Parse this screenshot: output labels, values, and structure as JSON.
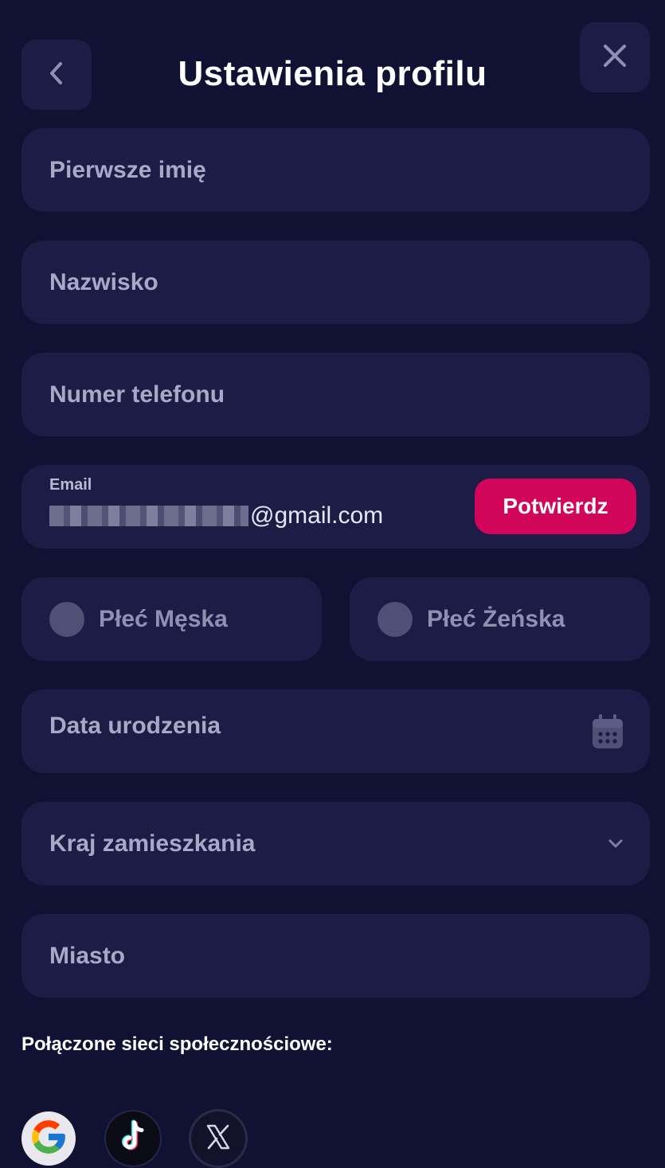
{
  "header": {
    "title": "Ustawienia profilu",
    "back_icon": "chevron-left-icon",
    "close_icon": "close-icon"
  },
  "form": {
    "first_name": {
      "placeholder": "Pierwsze imię"
    },
    "last_name": {
      "placeholder": "Nazwisko"
    },
    "phone": {
      "placeholder": "Numer telefonu"
    },
    "email": {
      "label": "Email",
      "value_domain": "@gmail.com",
      "confirm_label": "Potwierdz"
    },
    "gender": {
      "male": "Płeć Męska",
      "female": "Płeć Żeńska"
    },
    "birth_date": {
      "placeholder": "Data urodzenia",
      "icon": "calendar-icon"
    },
    "country": {
      "placeholder": "Kraj zamieszkania",
      "icon": "chevron-down-icon"
    },
    "city": {
      "placeholder": "Miasto"
    }
  },
  "social": {
    "title": "Połączone sieci społecznościowe:",
    "networks": [
      "google-icon",
      "tiktok-icon",
      "x-icon"
    ]
  },
  "colors": {
    "background": "#111133",
    "field": "#1c1d46",
    "accent": "#d1055a"
  }
}
